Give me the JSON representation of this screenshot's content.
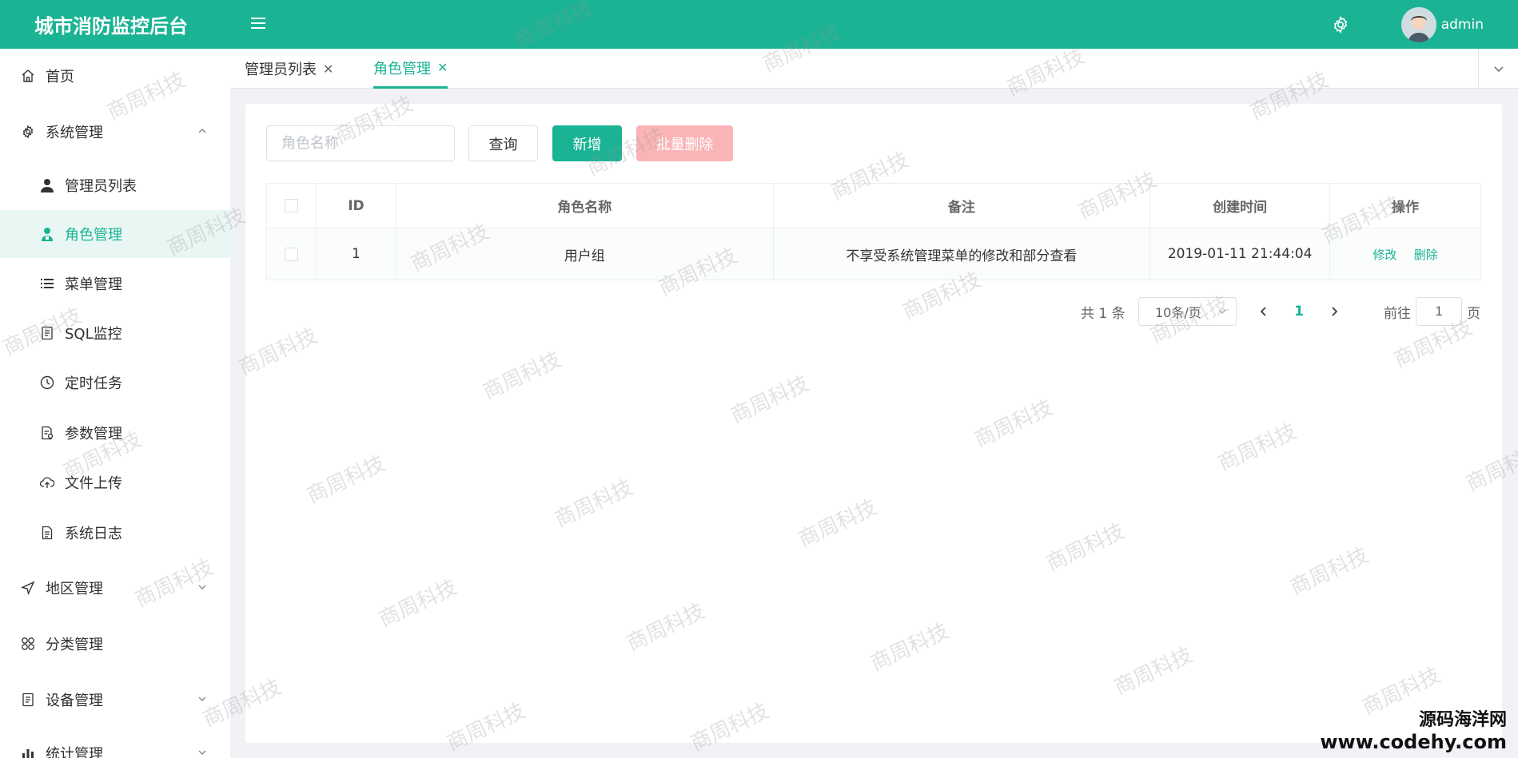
{
  "header": {
    "title": "城市消防监控后台",
    "username": "admin",
    "accent": "#1ab394"
  },
  "sidebar": {
    "items": [
      {
        "label": "首页",
        "icon": "home-icon"
      },
      {
        "label": "系统管理",
        "icon": "gear-icon",
        "expanded": true
      },
      {
        "label": "管理员列表",
        "icon": "user-icon"
      },
      {
        "label": "角色管理",
        "icon": "role-icon",
        "active": true
      },
      {
        "label": "菜单管理",
        "icon": "list-icon"
      },
      {
        "label": "SQL监控",
        "icon": "sql-icon"
      },
      {
        "label": "定时任务",
        "icon": "clock-icon"
      },
      {
        "label": "参数管理",
        "icon": "param-icon"
      },
      {
        "label": "文件上传",
        "icon": "upload-icon"
      },
      {
        "label": "系统日志",
        "icon": "log-icon"
      },
      {
        "label": "地区管理",
        "icon": "location-icon"
      },
      {
        "label": "分类管理",
        "icon": "category-icon"
      },
      {
        "label": "设备管理",
        "icon": "device-icon"
      },
      {
        "label": "统计管理",
        "icon": "stats-icon"
      }
    ]
  },
  "tabs": [
    {
      "label": "管理员列表"
    },
    {
      "label": "角色管理",
      "active": true
    }
  ],
  "toolbar": {
    "search_placeholder": "角色名称",
    "query_label": "查询",
    "add_label": "新增",
    "batch_delete_label": "批量删除"
  },
  "table": {
    "headers": [
      "ID",
      "角色名称",
      "备注",
      "创建时间",
      "操作"
    ],
    "rows": [
      {
        "id": "1",
        "name": "用户组",
        "remark": "不享受系统管理菜单的修改和部分查看",
        "created": "2019-01-11 21:44:04",
        "edit": "修改",
        "delete": "删除"
      }
    ]
  },
  "pagination": {
    "total_text": "共 1 条",
    "page_size": "10条/页",
    "current_page": "1",
    "goto_prefix": "前往",
    "goto_value": "1",
    "goto_suffix": "页"
  },
  "watermark": {
    "text": "商周科技",
    "site_name": "源码海洋网",
    "site_url": "www.codehy.com"
  }
}
